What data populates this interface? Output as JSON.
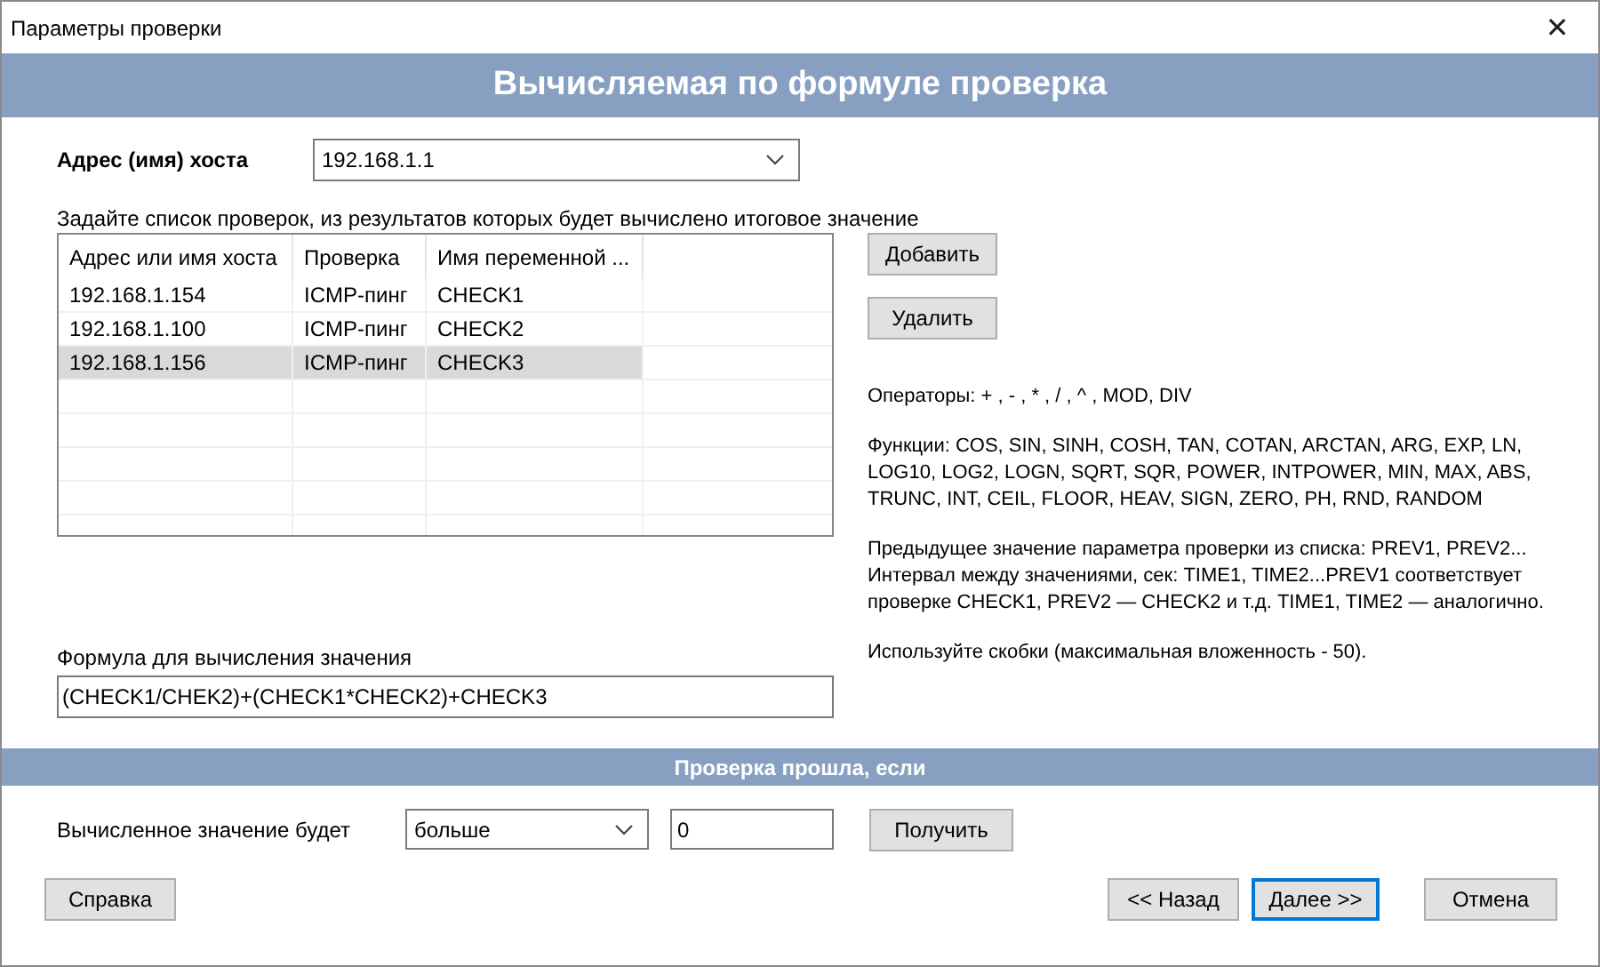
{
  "window": {
    "title": "Параметры проверки",
    "close": "✕"
  },
  "banner": "Вычисляемая по формуле проверка",
  "host": {
    "label": "Адрес (имя) хоста",
    "value": "192.168.1.1"
  },
  "list_hint": "Задайте список проверок, из результатов которых будет вычислено итоговое значение",
  "table": {
    "columns": [
      "Адрес или имя хоста",
      "Проверка",
      "Имя переменной ..."
    ],
    "rows": [
      {
        "cells": [
          "192.168.1.154",
          "ICMP-пинг",
          "CHECK1"
        ],
        "selected": false
      },
      {
        "cells": [
          "192.168.1.100",
          "ICMP-пинг",
          "CHECK2"
        ],
        "selected": false
      },
      {
        "cells": [
          "192.168.1.156",
          "ICMP-пинг",
          "CHECK3"
        ],
        "selected": true
      }
    ]
  },
  "side_buttons": [
    "Добавить",
    "Удалить"
  ],
  "help": [
    "Операторы: + , - , * , / , ^ , MOD, DIV",
    "Функции: COS, SIN, SINH, COSH, TAN, COTAN, ARCTAN, ARG, EXP, LN, LOG10, LOG2, LOGN, SQRT, SQR, POWER, INTPOWER, MIN, MAX, ABS, TRUNC, INT, CEIL, FLOOR, HEAV, SIGN, ZERO, PH, RND, RANDOM",
    "Предыдущее значение параметра проверки из списка: PREV1, PREV2... Интервал между значениями, сек: TIME1, TIME2...PREV1 соответствует проверке CHECK1, PREV2 — CHECK2 и т.д. TIME1, TIME2 — аналогично.",
    "Используйте скобки (максимальная вложенность - 50)."
  ],
  "formula": {
    "label": "Формула для вычисления значения",
    "value": "(CHECK1/CHEK2)+(CHECK1*CHECK2)+CHECK3"
  },
  "condition": {
    "section": "Проверка прошла, если",
    "label": "Вычисленное значение будет",
    "operator": "больше",
    "value": "0",
    "button": "Получить"
  },
  "footer": {
    "help": "Справка",
    "back": "<< Назад",
    "next": "Далее >>",
    "cancel": "Отмена"
  }
}
